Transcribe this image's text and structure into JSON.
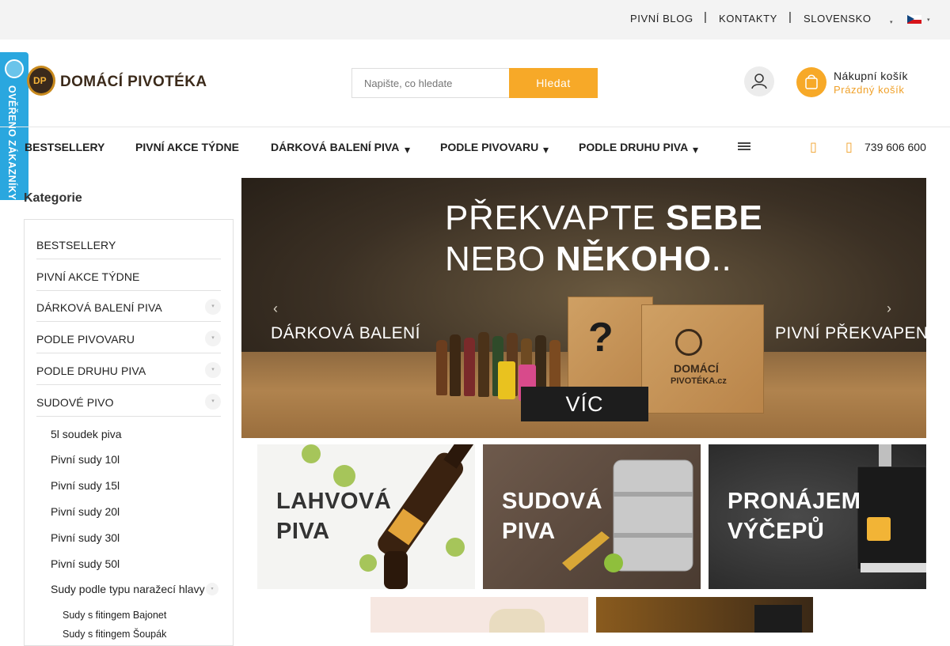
{
  "topbar": {
    "links": [
      "PIVNÍ BLOG",
      "KONTAKTY",
      "SLOVENSKO"
    ],
    "separator": "|"
  },
  "badge": {
    "text": "OVĚŘENO ZÁKAZNÍKY"
  },
  "header": {
    "logo_text": "DOMÁCÍ PIVOTÉKA",
    "logo_mark": "DP",
    "search_placeholder": "Napište, co hledate",
    "search_button": "Hledat",
    "cart_title": "Nákupní košík",
    "cart_status": "Prázdný košík"
  },
  "nav": {
    "items": [
      "BESTSELLERY",
      "PIVNÍ AKCE TÝDNE",
      "DÁRKOVÁ BALENÍ PIVA",
      "PODLE PIVOVARU",
      "PODLE DRUHU PIVA"
    ],
    "phone": "739 606 600"
  },
  "sidebar": {
    "title": "Kategorie",
    "categories": [
      "BESTSELLERY",
      "PIVNÍ AKCE TÝDNE",
      "DÁRKOVÁ BALENÍ PIVA",
      "PODLE PIVOVARU",
      "PODLE DRUHU PIVA",
      "SUDOVÉ PIVO"
    ],
    "subcategories": [
      "5l soudek piva",
      "Pivní sudy 10l",
      "Pivní sudy 15l",
      "Pivní sudy 20l",
      "Pivní sudy 30l",
      "Pivní sudy 50l",
      "Sudy podle typu naražecí hlavy"
    ],
    "subsub": [
      "Sudy s fitingem Bajonet",
      "Sudy s fitingem Šoupák"
    ]
  },
  "banner": {
    "line1_light": "PŘEKVAPTE ",
    "line1_bold": "SEBE",
    "line2_light": "NEBO ",
    "line2_bold": "NĚKOHO",
    "line2_end": "..",
    "left_label": "DÁRKOVÁ BALENÍ",
    "right_label": "PIVNÍ PŘEKVAPENÍ",
    "button": "VÍC",
    "box_text_1": "DOMÁCÍ",
    "box_text_2": "PIVOTÉKA.cz"
  },
  "tiles": [
    {
      "line1": "LAHVOVÁ",
      "line2": "PIVA"
    },
    {
      "line1": "SUDOVÁ",
      "line2": "PIVA"
    },
    {
      "line1": "PRONÁJEM",
      "line2": "VÝČEPŮ"
    }
  ],
  "colors": {
    "accent": "#f7a928",
    "badge": "#2aa7df",
    "text": "#222222"
  }
}
